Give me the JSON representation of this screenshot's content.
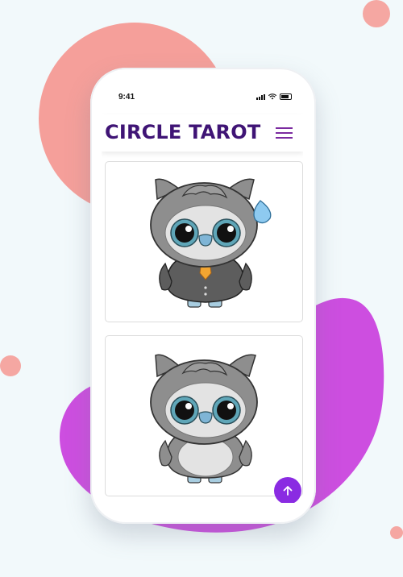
{
  "status_bar": {
    "time": "9:41",
    "icons": [
      "signal-icon",
      "wifi-icon",
      "battery-icon"
    ]
  },
  "app": {
    "title": "CIRCLE TAROT",
    "menu_icon": "hamburger-menu-icon"
  },
  "cards": [
    {
      "image": "owl-in-suit-sweating-illustration"
    },
    {
      "image": "owl-plain-illustration"
    }
  ],
  "fab": {
    "icon": "arrow-up-icon"
  },
  "colors": {
    "title": "#3f1475",
    "accent": "#8a2be2",
    "blob_coral": "#f59f9a",
    "blob_purple": "#cd4ee0",
    "background": "#f2f9fb"
  }
}
